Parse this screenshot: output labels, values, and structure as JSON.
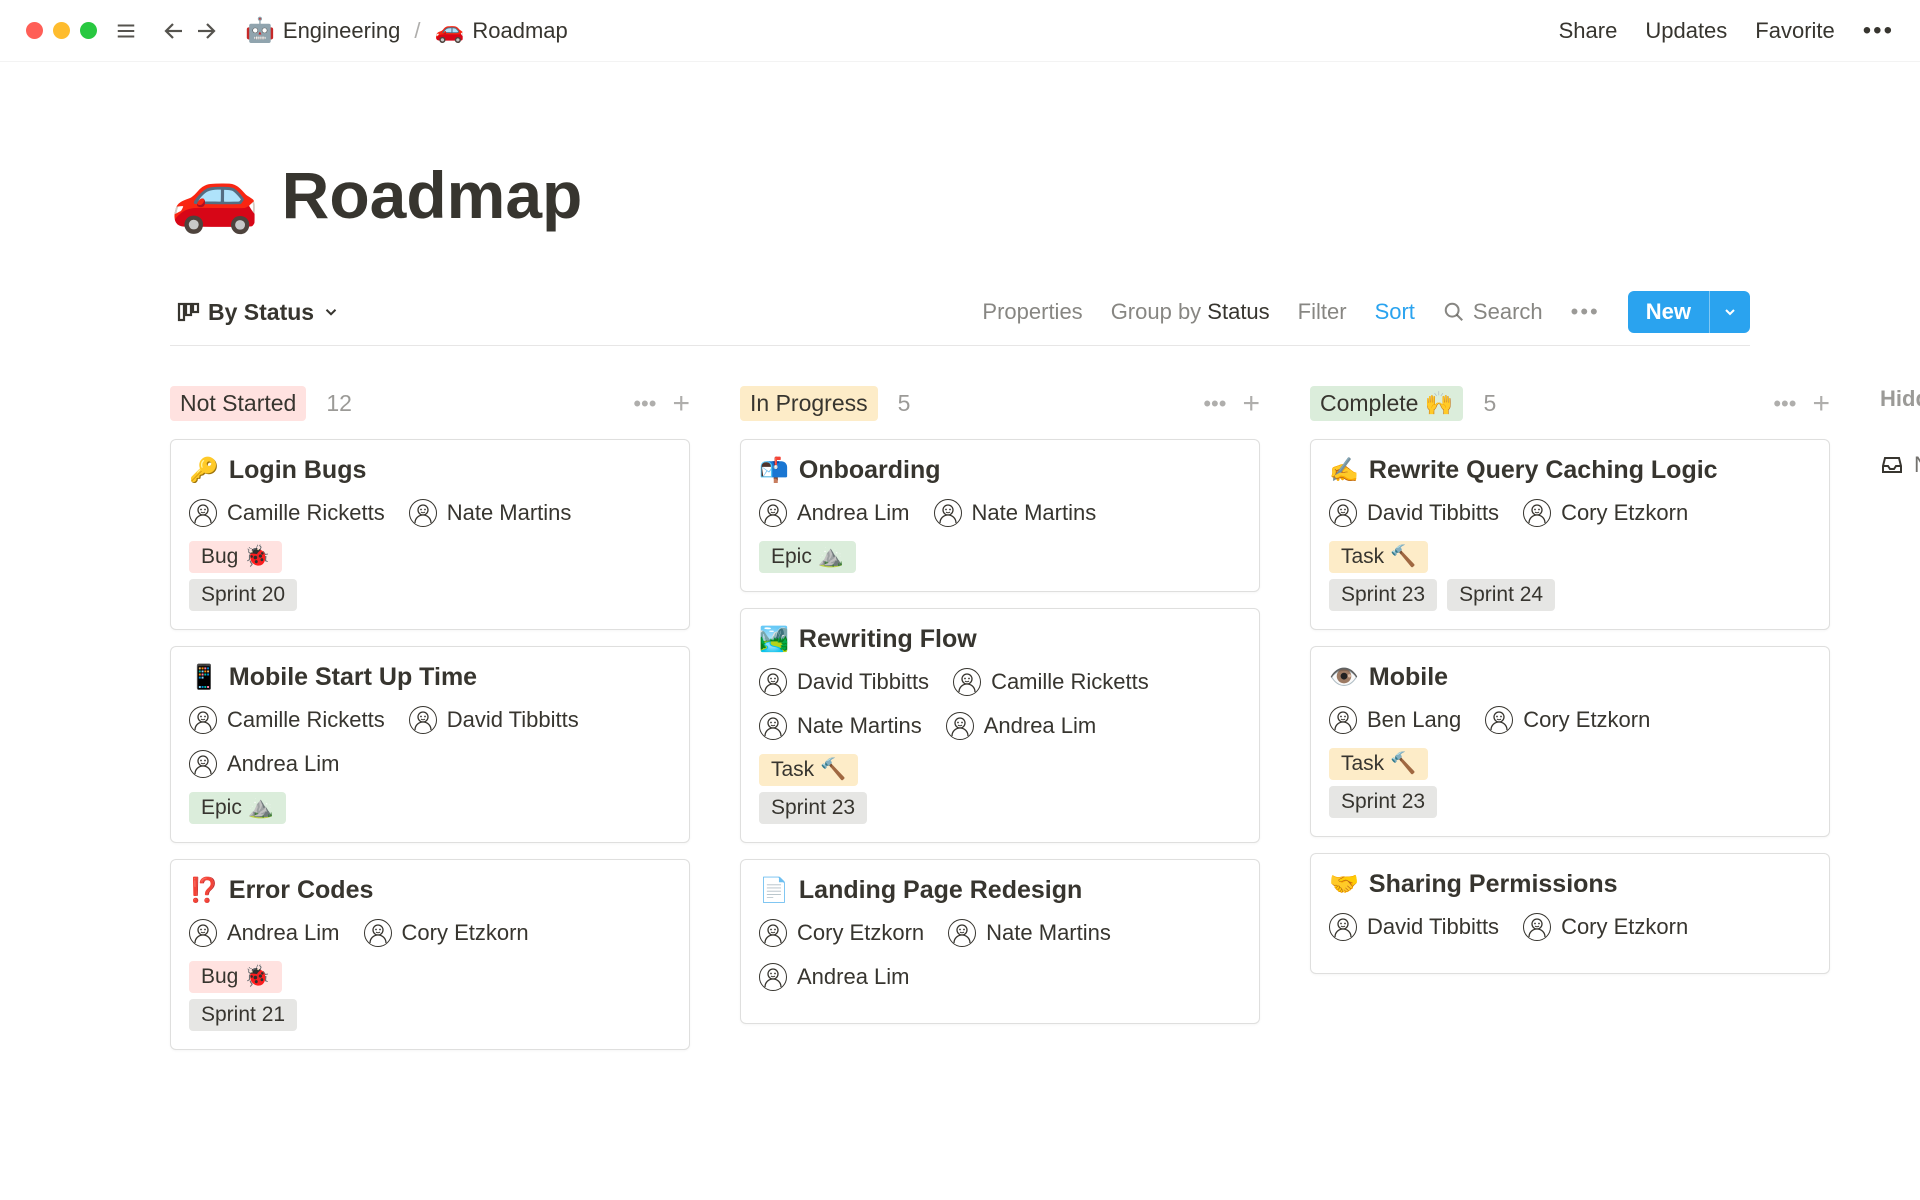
{
  "chrome": {
    "breadcrumb": [
      {
        "emoji": "🤖",
        "label": "Engineering"
      },
      {
        "emoji": "🚗",
        "label": "Roadmap"
      }
    ],
    "actions": {
      "share": "Share",
      "updates": "Updates",
      "favorite": "Favorite"
    }
  },
  "page": {
    "emoji": "🚗",
    "title": "Roadmap"
  },
  "toolbar": {
    "view_label": "By Status",
    "properties": "Properties",
    "group_by_prefix": "Group by ",
    "group_by_value": "Status",
    "filter": "Filter",
    "sort": "Sort",
    "search": "Search",
    "new": "New"
  },
  "board": {
    "columns": [
      {
        "status_label": "Not Started",
        "pill_class": "pill-notstarted",
        "count": "12",
        "cards": [
          {
            "emoji": "🔑",
            "title": "Login Bugs",
            "assignees": [
              {
                "name": "Camille Ricketts",
                "avatar_key": "camille"
              },
              {
                "name": "Nate Martins",
                "avatar_key": "nate"
              }
            ],
            "type_tag": {
              "label": "Bug 🐞",
              "class": "tag-bug"
            },
            "sprint_tags": [
              "Sprint 20"
            ]
          },
          {
            "emoji": "📱",
            "title": "Mobile Start Up Time",
            "assignees": [
              {
                "name": "Camille Ricketts",
                "avatar_key": "camille"
              },
              {
                "name": "David Tibbitts",
                "avatar_key": "david"
              },
              {
                "name": "Andrea Lim",
                "avatar_key": "andrea"
              }
            ],
            "type_tag": {
              "label": "Epic ⛰️",
              "class": "tag-epic"
            },
            "sprint_tags": []
          },
          {
            "emoji": "⁉️",
            "title": "Error Codes",
            "assignees": [
              {
                "name": "Andrea Lim",
                "avatar_key": "andrea"
              },
              {
                "name": "Cory Etzkorn",
                "avatar_key": "cory"
              }
            ],
            "type_tag": {
              "label": "Bug 🐞",
              "class": "tag-bug"
            },
            "sprint_tags": [
              "Sprint 21"
            ]
          }
        ]
      },
      {
        "status_label": "In Progress",
        "pill_class": "pill-inprogress",
        "count": "5",
        "cards": [
          {
            "emoji": "📬",
            "title": "Onboarding",
            "assignees": [
              {
                "name": "Andrea Lim",
                "avatar_key": "andrea"
              },
              {
                "name": "Nate Martins",
                "avatar_key": "nate"
              }
            ],
            "type_tag": {
              "label": "Epic ⛰️",
              "class": "tag-epic"
            },
            "sprint_tags": []
          },
          {
            "emoji": "🏞️",
            "title": "Rewriting Flow",
            "assignees": [
              {
                "name": "David Tibbitts",
                "avatar_key": "david"
              },
              {
                "name": "Camille Ricketts",
                "avatar_key": "camille"
              },
              {
                "name": "Nate Martins",
                "avatar_key": "nate"
              },
              {
                "name": "Andrea Lim",
                "avatar_key": "andrea"
              }
            ],
            "type_tag": {
              "label": "Task 🔨",
              "class": "tag-task"
            },
            "sprint_tags": [
              "Sprint 23"
            ]
          },
          {
            "emoji": "📄",
            "title": "Landing Page Redesign",
            "assignees": [
              {
                "name": "Cory Etzkorn",
                "avatar_key": "cory"
              },
              {
                "name": "Nate Martins",
                "avatar_key": "nate"
              },
              {
                "name": "Andrea Lim",
                "avatar_key": "andrea"
              }
            ],
            "type_tag": null,
            "sprint_tags": []
          }
        ]
      },
      {
        "status_label": "Complete 🙌",
        "pill_class": "pill-complete",
        "count": "5",
        "cards": [
          {
            "emoji": "✍️",
            "title": "Rewrite Query Caching Logic",
            "assignees": [
              {
                "name": "David Tibbitts",
                "avatar_key": "david"
              },
              {
                "name": "Cory Etzkorn",
                "avatar_key": "cory"
              }
            ],
            "type_tag": {
              "label": "Task 🔨",
              "class": "tag-task"
            },
            "sprint_tags": [
              "Sprint 23",
              "Sprint 24"
            ]
          },
          {
            "emoji": "👁️",
            "title": "Mobile",
            "assignees": [
              {
                "name": "Ben Lang",
                "avatar_key": "ben"
              },
              {
                "name": "Cory Etzkorn",
                "avatar_key": "cory"
              }
            ],
            "type_tag": {
              "label": "Task 🔨",
              "class": "tag-task"
            },
            "sprint_tags": [
              "Sprint 23"
            ]
          },
          {
            "emoji": "🤝",
            "title": "Sharing Permissions",
            "assignees": [
              {
                "name": "David Tibbitts",
                "avatar_key": "david"
              },
              {
                "name": "Cory Etzkorn",
                "avatar_key": "cory"
              }
            ],
            "type_tag": null,
            "sprint_tags": []
          }
        ]
      }
    ],
    "hidden": {
      "label": "Hidden",
      "item_label": "No"
    }
  }
}
